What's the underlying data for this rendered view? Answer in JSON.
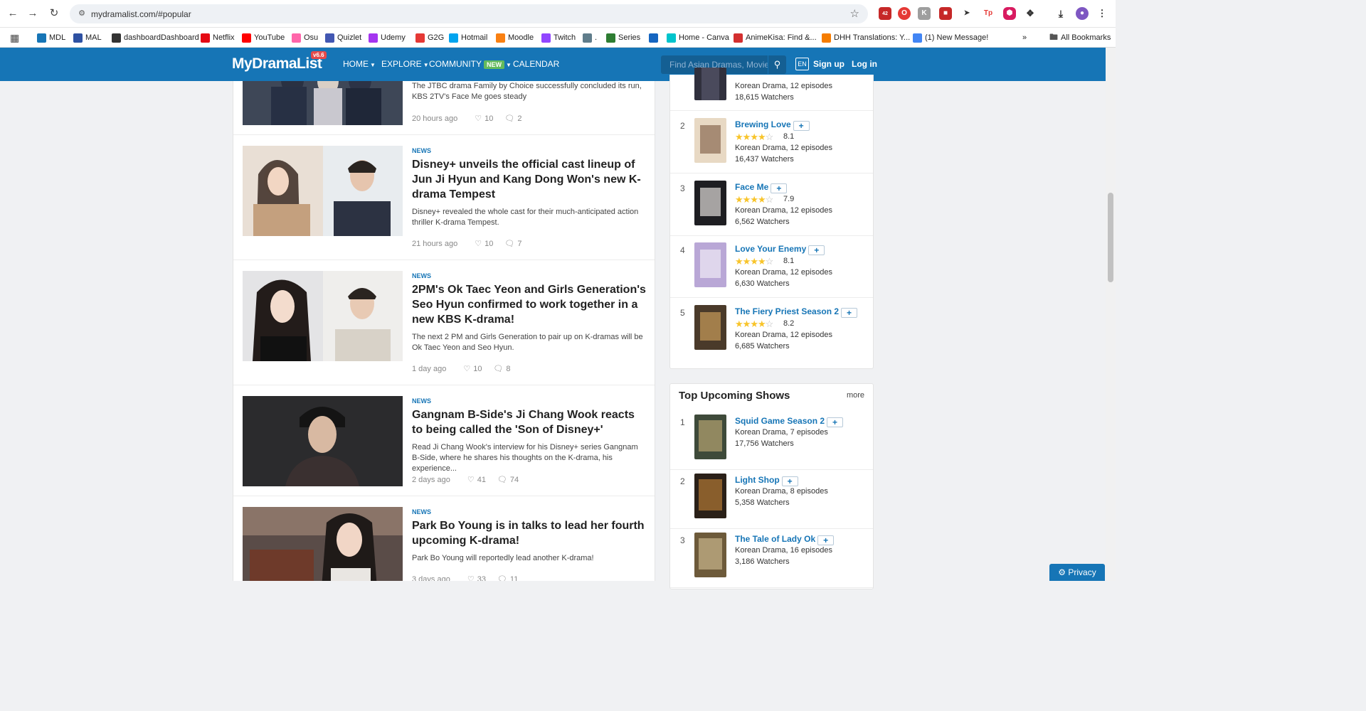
{
  "browser": {
    "url": "mydramalist.com/#popular",
    "bookmarks": [
      {
        "label": "MDL",
        "icon": "mdl-icon",
        "color": "#1675b6"
      },
      {
        "label": "MAL",
        "icon": "mal-icon",
        "color": "#2e51a2"
      },
      {
        "label": "dashboardDashboard",
        "icon": "dashboard-icon",
        "color": "#333333"
      },
      {
        "label": "Netflix",
        "icon": "netflix-icon",
        "color": "#e50914"
      },
      {
        "label": "YouTube",
        "icon": "youtube-icon",
        "color": "#ff0000"
      },
      {
        "label": "Osu",
        "icon": "osu-icon",
        "color": "#ff66aa"
      },
      {
        "label": "Quizlet",
        "icon": "quizlet-icon",
        "color": "#4257b2"
      },
      {
        "label": "Udemy",
        "icon": "udemy-icon",
        "color": "#a435f0"
      },
      {
        "label": "G2G",
        "icon": "g2g-icon",
        "color": "#e53935"
      },
      {
        "label": "Hotmail",
        "icon": "hotmail-icon",
        "color": "#00a4ef"
      },
      {
        "label": "Moodle",
        "icon": "moodle-icon",
        "color": "#f98012"
      },
      {
        "label": "Twitch",
        "icon": "twitch-icon",
        "color": "#9146ff"
      },
      {
        "label": ".",
        "icon": "generic-icon",
        "color": "#607d8b"
      },
      {
        "label": "Series",
        "icon": "series-icon",
        "color": "#2e7d32"
      },
      {
        "label": "",
        "icon": "r-icon",
        "color": "#1565c0"
      },
      {
        "label": "Home - Canva",
        "icon": "canva-icon",
        "color": "#00c4cc"
      },
      {
        "label": "AnimeKisa: Find &...",
        "icon": "animekisa-icon",
        "color": "#d32f2f"
      },
      {
        "label": "DHH Translations: Y...",
        "icon": "blogger-icon",
        "color": "#f57c00"
      },
      {
        "label": "(1) New Message!",
        "icon": "google-icon",
        "color": "#4285f4"
      }
    ],
    "more_label": "»",
    "all_bookmarks": "All Bookmarks"
  },
  "header": {
    "logo": "MyDramaList",
    "version": "v6.6",
    "menu": {
      "home": "HOME",
      "explore": "EXPLORE",
      "community": "COMMUNITY",
      "community_badge": "NEW",
      "calendar": "CALENDAR"
    },
    "search_placeholder": "Find Asian Dramas, Movies...",
    "lang": "EN",
    "signup": "Sign up",
    "login": "Log in"
  },
  "articles": [
    {
      "tag": "",
      "title": "",
      "desc": "The JTBC drama Family by Choice successfully concluded its run, KBS 2TV's Face Me goes steady",
      "time": "20 hours ago",
      "likes": "10",
      "comments": "2"
    },
    {
      "tag": "NEWS",
      "title": "Disney+ unveils the official cast lineup of Jun Ji Hyun and Kang Dong Won's new K-drama Tempest",
      "desc": "Disney+ revealed the whole cast for their much-anticipated action thriller K-drama Tempest.",
      "time": "21 hours ago",
      "likes": "10",
      "comments": "7"
    },
    {
      "tag": "NEWS",
      "title": "2PM's Ok Taec Yeon and Girls Generation's Seo Hyun confirmed to work together in a new KBS K-drama!",
      "desc": "The next 2 PM and Girls Generation to pair up on K-dramas will be Ok Taec Yeon and Seo Hyun.",
      "time": "1 day ago",
      "likes": "10",
      "comments": "8"
    },
    {
      "tag": "NEWS",
      "title": "Gangnam B-Side's Ji Chang Wook reacts to being called the 'Son of Disney+'",
      "desc": "Read Ji Chang Wook's interview for his Disney+ series Gangnam B-Side, where he shares his thoughts on the K-drama, his experience...",
      "time": "2 days ago",
      "likes": "41",
      "comments": "74"
    },
    {
      "tag": "NEWS",
      "title": "Park Bo Young is in talks to lead her fourth upcoming K-drama!",
      "desc": "Park Bo Young will reportedly lead another K-drama!",
      "time": "3 days ago",
      "likes": "33",
      "comments": "11"
    }
  ],
  "top_airing": {
    "partial_first": {
      "meta": "Korean Drama, 12 episodes",
      "watchers": "18,615 Watchers"
    },
    "items": [
      {
        "rank": "2",
        "title": "Brewing Love",
        "stars": 4,
        "rating": "8.1",
        "meta": "Korean Drama, 12 episodes",
        "watchers": "16,437 Watchers"
      },
      {
        "rank": "3",
        "title": "Face Me",
        "stars": 4,
        "rating": "7.9",
        "meta": "Korean Drama, 12 episodes",
        "watchers": "6,562 Watchers"
      },
      {
        "rank": "4",
        "title": "Love Your Enemy",
        "stars": 4,
        "rating": "8.1",
        "meta": "Korean Drama, 12 episodes",
        "watchers": "6,630 Watchers"
      },
      {
        "rank": "5",
        "title": "The Fiery Priest Season 2",
        "stars": 4,
        "rating": "8.2",
        "meta": "Korean Drama, 12 episodes",
        "watchers": "6,685 Watchers"
      }
    ],
    "add_label": "+"
  },
  "upcoming": {
    "title": "Top Upcoming Shows",
    "more": "more",
    "items": [
      {
        "rank": "1",
        "title": "Squid Game Season 2",
        "meta": "Korean Drama, 7 episodes",
        "watchers": "17,756 Watchers"
      },
      {
        "rank": "2",
        "title": "Light Shop",
        "meta": "Korean Drama, 8 episodes",
        "watchers": "5,358 Watchers"
      },
      {
        "rank": "3",
        "title": "The Tale of Lady Ok",
        "meta": "Korean Drama, 16 episodes",
        "watchers": "3,186 Watchers"
      }
    ]
  },
  "privacy": "Privacy",
  "ext_badge": "42",
  "colors": {
    "brand": "#1675b6",
    "star": "#f8c42a",
    "new_badge": "#64bb5d"
  }
}
